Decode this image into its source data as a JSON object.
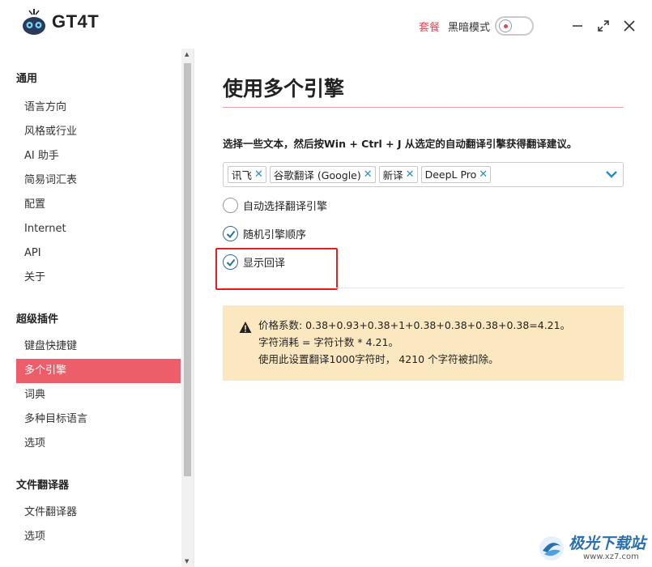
{
  "app": {
    "logo_text": "GT4T"
  },
  "titlebar": {
    "plan_label": "套餐",
    "dark_mode_label": "黑暗模式",
    "dark_mode_on": false
  },
  "sidebar": {
    "section_general": "通用",
    "general_items": [
      "语言方向",
      "风格或行业",
      "AI 助手",
      "简易词汇表",
      "配置",
      "Internet",
      "API",
      "关于"
    ],
    "section_plugins": "超级插件",
    "plugin_items": [
      "键盘快捷键",
      "多个引擎",
      "词典",
      "多种目标语言",
      "选项"
    ],
    "active_item": "多个引擎",
    "section_file": "文件翻译器",
    "file_items": [
      "文件翻译器",
      "选项"
    ]
  },
  "main": {
    "title": "使用多个引擎",
    "description": "选择一些文本，然后按Win + Ctrl + J 从选定的自动翻译引擎获得翻译建议。",
    "engines": [
      "讯飞",
      "谷歌翻译 (Google)",
      "新译",
      "DeepL Pro"
    ],
    "options": [
      {
        "label": "自动选择翻译引擎",
        "checked": false
      },
      {
        "label": "随机引擎顺序",
        "checked": true
      },
      {
        "label": "显示回译",
        "checked": true
      }
    ],
    "warning": {
      "line1": "价格系数:   0.38+0.93+0.38+1+0.38+0.38+0.38+0.38=4.21。",
      "line2": "字符消耗 = 字符计数 * 4.21。",
      "line3": "使用此设置翻译1000字符时，  4210 个字符被扣除。"
    }
  },
  "watermark": {
    "title": "极光下载站",
    "url": "www.xz7.com"
  },
  "colors": {
    "accent": "#ec5f6a",
    "link": "#d94b57",
    "check": "#2c6e94",
    "warning_bg": "#fbe8c0",
    "highlight_box": "#e02020"
  }
}
